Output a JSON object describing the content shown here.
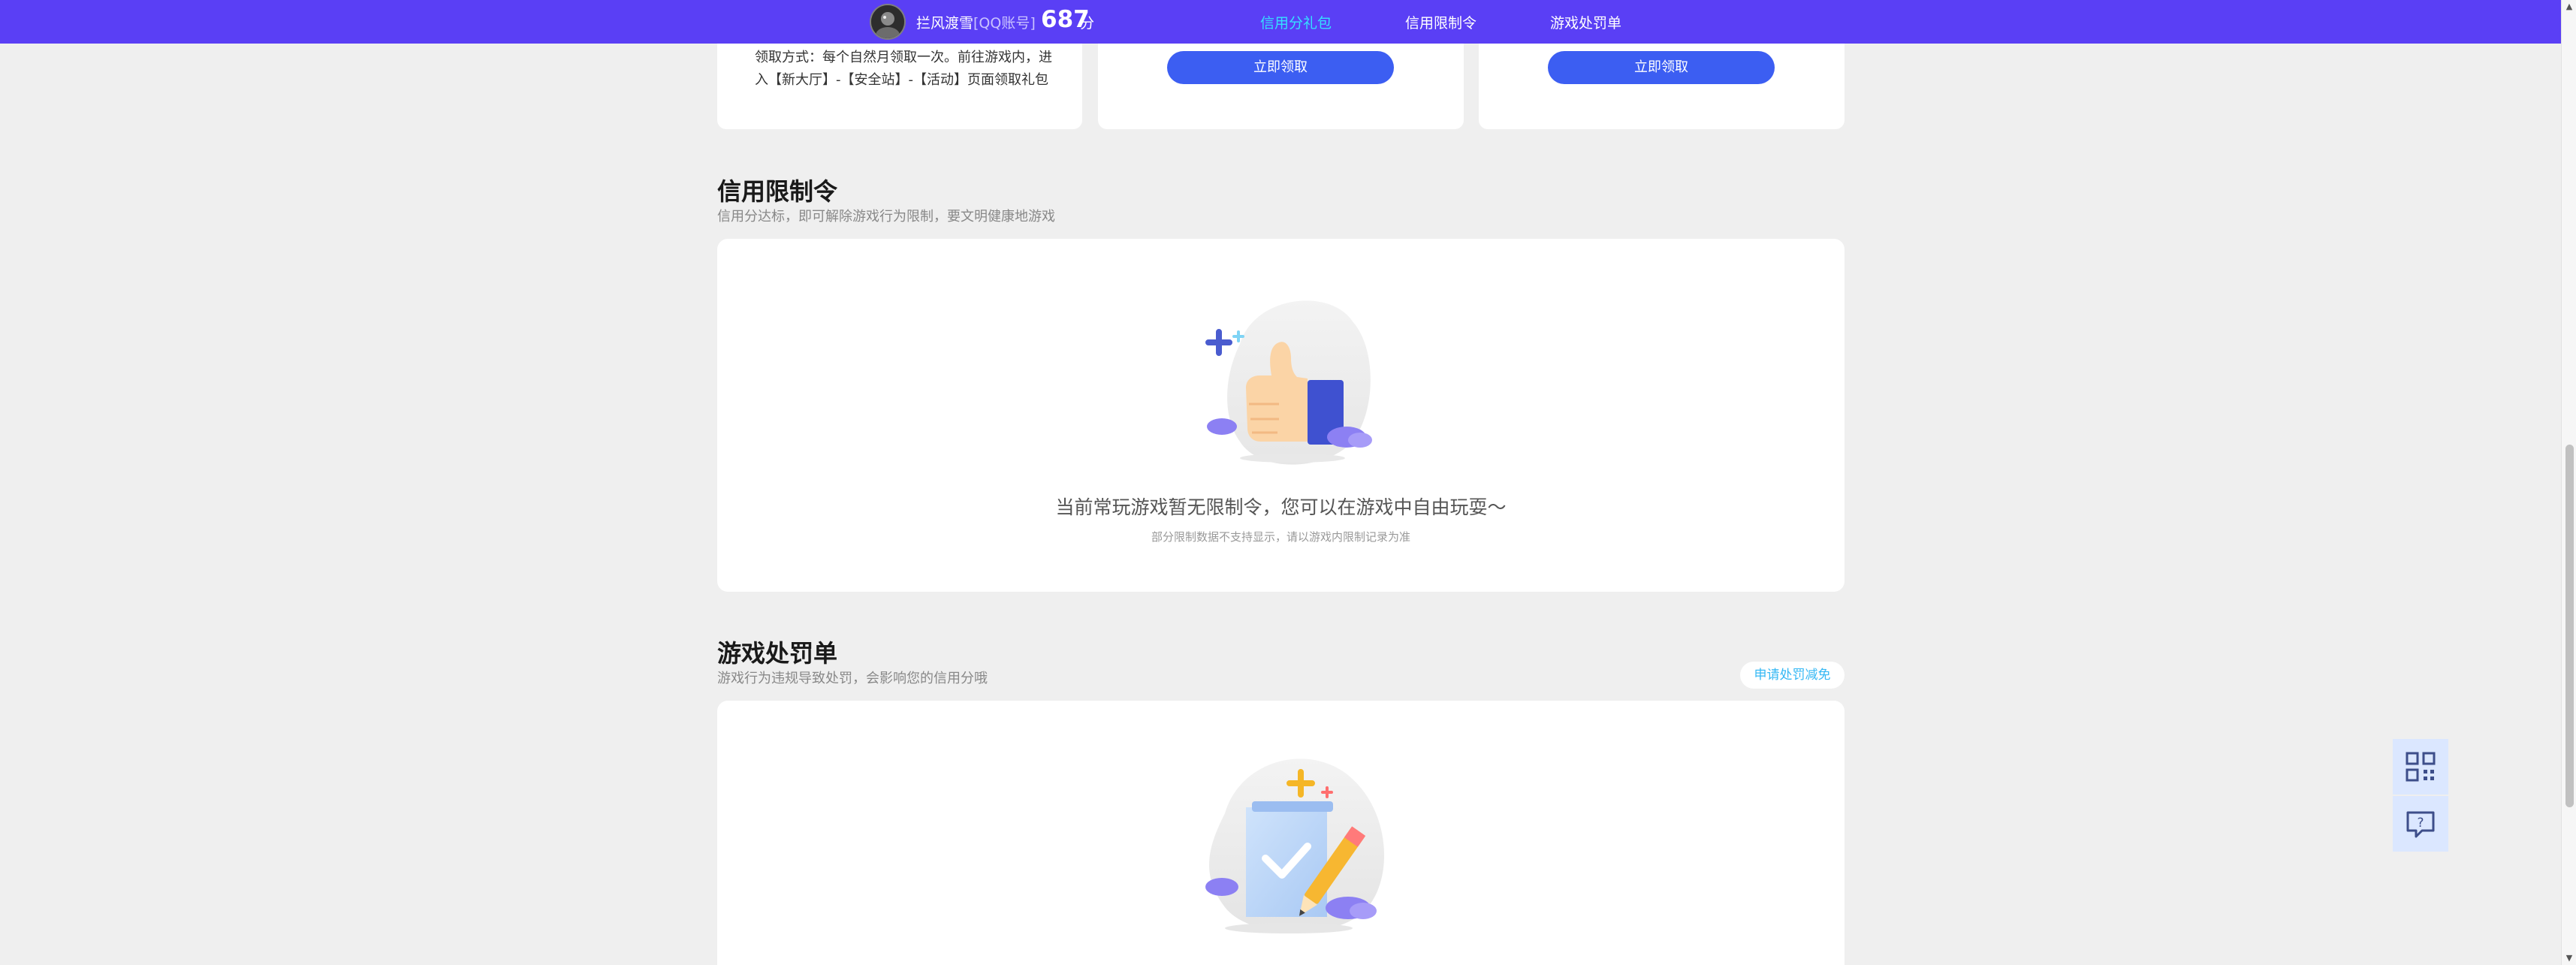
{
  "topbar": {
    "username": "拦风渡雪",
    "account_type": "[QQ账号]",
    "score": "687",
    "score_unit": "分",
    "nav": [
      "信用分礼包",
      "信用限制令",
      "游戏处罚单"
    ],
    "active_nav_index": 0,
    "bg_color": "#5a3ff5",
    "active_color": "#35e0ff"
  },
  "gift_cards": [
    {
      "method_text": "领取方式：每个自然月领取一次。前往游戏内，进入【新大厅】-【安全站】-【活动】页面领取礼包"
    },
    {
      "button_label": "立即领取"
    },
    {
      "button_label": "立即领取"
    }
  ],
  "restriction": {
    "title": "信用限制令",
    "subtitle": "信用分达标，即可解除游戏行为限制，要文明健康地游戏",
    "empty_main": "当前常玩游戏暂无限制令，您可以在游戏中自由玩耍～",
    "empty_sub": "部分限制数据不支持显示，请以游戏内限制记录为准",
    "illustration_icon": "thumbs-up-icon"
  },
  "penalty": {
    "title": "游戏处罚单",
    "subtitle": "游戏行为违规导致处罚，会影响您的信用分哦",
    "appeal_label": "申请处罚减免",
    "illustration_icon": "checklist-pencil-icon"
  },
  "float_buttons": [
    {
      "icon": "qr-code-icon"
    },
    {
      "icon": "feedback-question-icon"
    }
  ],
  "colors": {
    "primary_button": "#3c5ef2",
    "link_blue": "#35b8f4",
    "float_bg": "#dbe7ff"
  }
}
